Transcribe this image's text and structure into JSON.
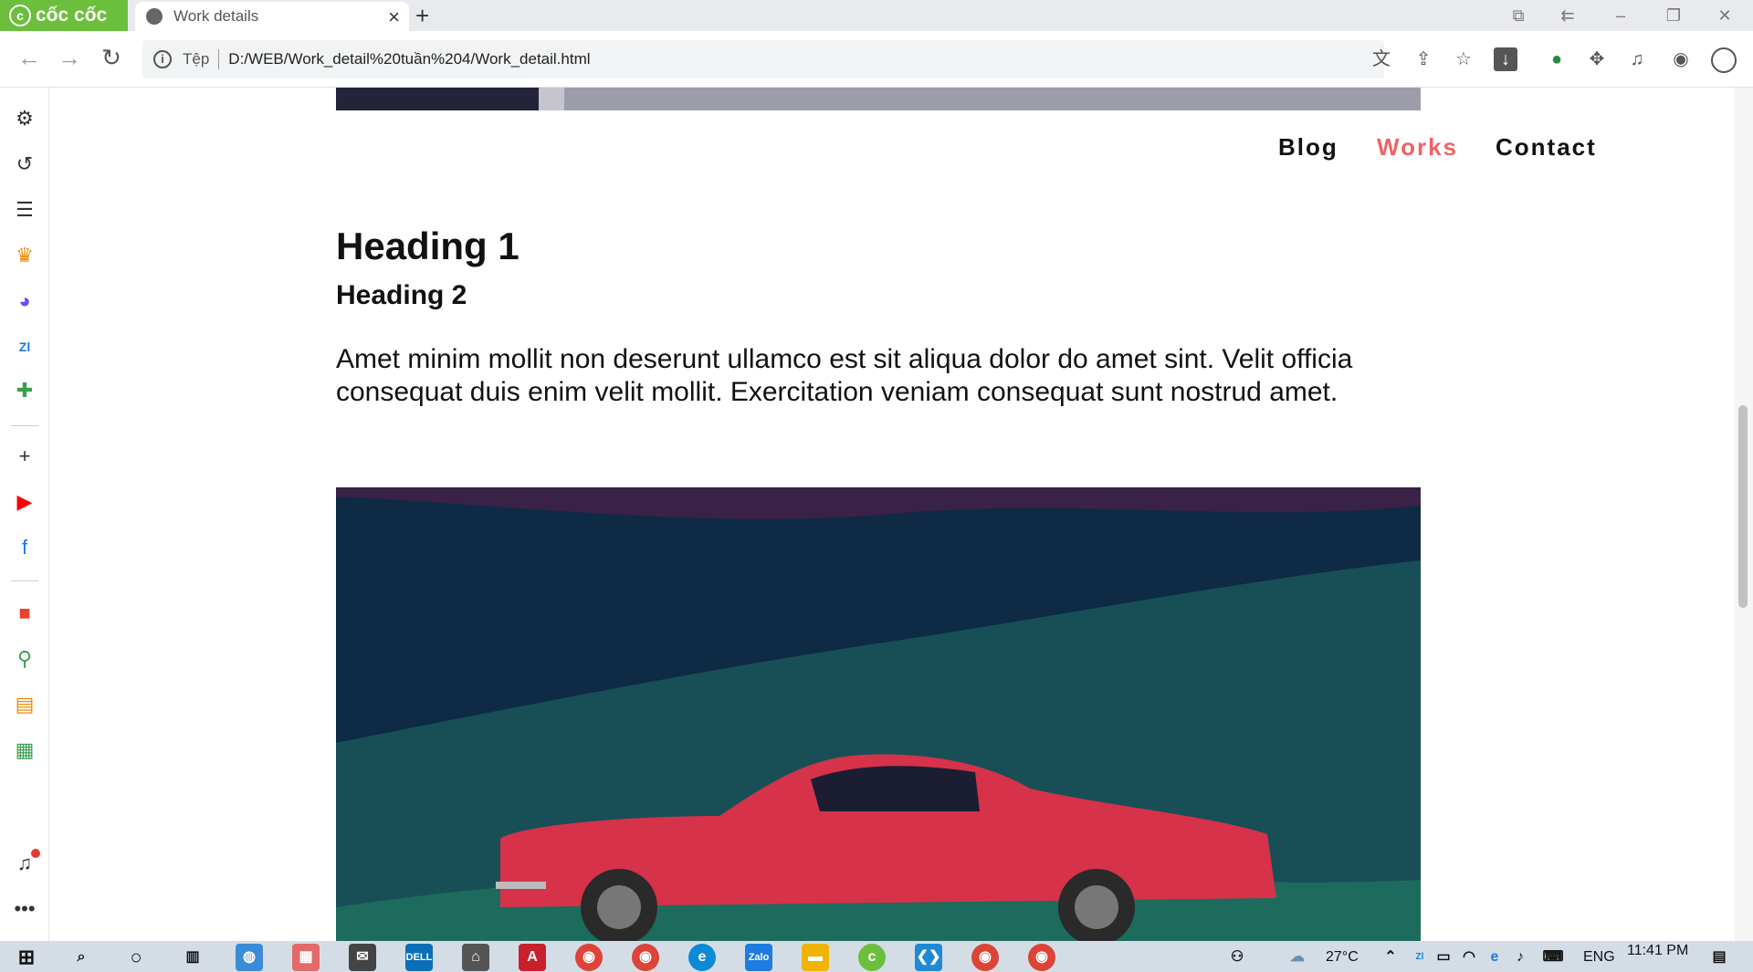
{
  "browser": {
    "brand": "cốc cốc",
    "tab_title": "Work details",
    "address_scheme": "Tệp",
    "url": "D:/WEB/Work_detail%20tuần%204/Work_detail.html"
  },
  "page": {
    "nav": {
      "blog": "Blog",
      "works": "Works",
      "contact": "Contact"
    },
    "heading1": "Heading 1",
    "heading2": "Heading 2",
    "paragraph": "Amet minim mollit non deserunt ullamco est sit aliqua dolor do amet sint. Velit officia consequat duis enim velit mollit. Exercitation veniam consequat sunt nostrud amet."
  },
  "colors": {
    "accent": "#f06464",
    "brand_green": "#6cbf3c"
  },
  "taskbar": {
    "weather": "27°C",
    "language": "ENG",
    "time": "11:41 PM"
  },
  "icons": [
    "settings-icon",
    "history-icon",
    "reading-list-icon",
    "crown-icon",
    "messenger-icon",
    "zalo-icon",
    "game-icon",
    "add-icon",
    "youtube-icon",
    "facebook-icon",
    "shopping-icon",
    "extension-icon",
    "bell-icon",
    "more-icon"
  ]
}
